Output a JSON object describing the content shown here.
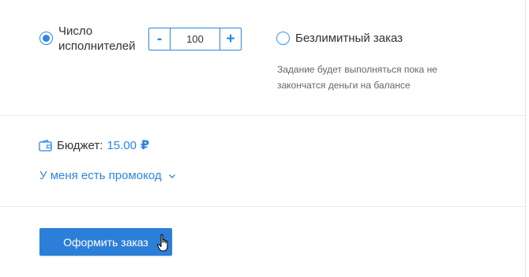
{
  "mode": {
    "limited": {
      "label_line1": "Число",
      "label_line2": "исполнителей",
      "selected": true
    },
    "stepper": {
      "minus": "-",
      "value": "100",
      "plus": "+"
    },
    "unlimited": {
      "label": "Безлимитный заказ",
      "selected": false,
      "hint_line1": "Задание будет выполняться пока не",
      "hint_line2": "закончатся деньги на балансе"
    }
  },
  "budget": {
    "label": "Бюджет:",
    "value": "15.00",
    "currency": "₽",
    "icon": "wallet-icon"
  },
  "promo": {
    "label": "У меня есть промокод",
    "icon": "chevron-down-icon"
  },
  "submit": {
    "label": "Оформить заказ"
  },
  "colors": {
    "accent": "#2b86e5",
    "button": "#2c7fd8"
  }
}
